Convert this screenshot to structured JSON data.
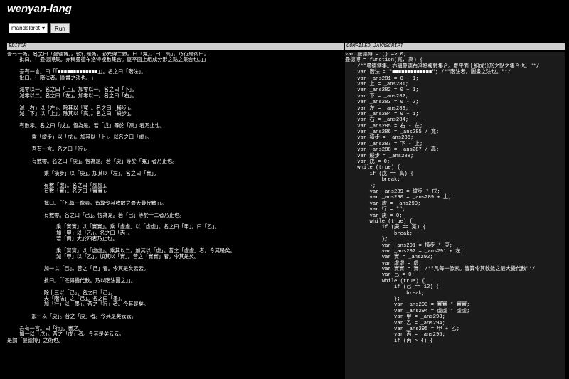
{
  "app": {
    "title": "wenyan-lang"
  },
  "toolbar": {
    "example_selected": "mandelbrot",
    "run_label": "Run"
  },
  "panes": {
    "editor_title": "EDITOR",
    "compiled_title": "COMPILED JAVASCRIPT"
  },
  "editor_lines": [
    "吾有一術。名之曰「曼德博」。欲行是術。必先得二數。曰「寬」。曰「高」。乃行是術曰。",
    "    批曰。「「曼德博集。亦稱曼德布洛特複數集合。夏平面上組成分形之點之集合也。」」",
    "",
    "    吾有一言。曰「「■■■■■■■■■■■■■」」。名之曰「階法」。",
    "    批曰。「「階法者。圖畫之法也。」」",
    "",
    "    減零以一。名之曰「上」。加零以一。名之曰「下」。",
    "    減零以二。名之曰「左」。加零以一。名之曰「右」。",
    "",
    "    減「右」以「左」。除其以「寬」。名之曰「橫步」。",
    "    減「下」以「上」。除其以「高」。名之曰「縱步」。",
    "",
    "    有數零。名之曰「戊」。恆為是。若「戊」等於「高」者乃止也。",
    "",
    "        乘「縱步」以「戊」。加其以「上」。以名之曰「虛」。",
    "",
    "        吾有一言。名之曰「行」。",
    "",
    "        有數零。名之曰「庚」。恆為是。若「庚」等於「寬」者乃止也。",
    "",
    "            乘「橫步」以「庚」。加其以「左」。名之曰「實」。",
    "",
    "            有數「虛」。名之曰「虛虛」。",
    "            有數「實」。名之曰「實實」。",
    "",
    "            批曰。「「凡每一像素。皆算令其收斂之最大疊代數」」。",
    "",
    "            有數零。名之曰「己」。恆為是。若「己」等於十二者乃止也。",
    "",
    "                乘「實實」以「實實」。乘「虛虛」以「虛虛」。名之曰「甲」。曰「乙」。",
    "                加「甲」以「乙」。名之曰「丙」。",
    "                若「丙」大於四者乃止也。",
    "",
    "                乘「實實」以「虛虛」。乘其以二。加其以「虛」。昔之「虛虛」者。今其是矣。",
    "                減「甲」以「乙」。加其以「實」。昔之「實實」者。今其是矣。",
    "",
    "            加一以「己」。昔之「己」者。今其是矣云云。",
    "",
    "            批曰。「「既得疊代數。乃以階法圖之」」。",
    "",
    "            除十三以「己」。名之曰「己」。",
    "            夫「階法」之「己」。名之曰「墨」。",
    "            加「行」以「墨」。昔之「行」者。今其是矣。",
    "",
    "        加一以「庚」。昔之「庚」者。今其是矣云云。",
    "",
    "    吾有一言。曰「行」。書之。",
    "    加一以「戊」。昔之「戊」者。今其是矣云云。",
    "是謂「曼德博」之術也。"
  ],
  "compiled_lines": [
    "var 曼德博 = () => 0;",
    "曼德博 = function(寬, 高) {",
    "    /*\"曼德博集。亦稱曼德布洛特複數集合。夏平面上組成分形之點之集合也。\"*/",
    "    var 階法 = \"■■■■■■■■■■■■■\"; /*\"階法者。圖畫之法也。\"*/",
    "    var _ans281 = 0 - 1;",
    "    var 上 = _ans281;",
    "    var _ans282 = 0 + 1;",
    "    var 下 = _ans282;",
    "    var _ans283 = 0 - 2;",
    "    var 左 = _ans283;",
    "    var _ans284 = 0 + 1;",
    "    var 右 = _ans284;",
    "    var _ans285 = 右 - 左;",
    "    var _ans286 = _ans285 / 寬;",
    "    var 橫步 = _ans286;",
    "    var _ans287 = 下 - 上;",
    "    var _ans288 = _ans287 / 高;",
    "    var 縱步 = _ans288;",
    "    var 戊 = 0;",
    "    while (true) {",
    "        if (戊 == 高) {",
    "            break;",
    "        };",
    "        var _ans289 = 縱步 * 戊;",
    "        var _ans290 = _ans289 + 上;",
    "        var 虛 = _ans290;",
    "        var 行 = \"\";",
    "        var 庚 = 0;",
    "        while (true) {",
    "            if (庚 == 寬) {",
    "                break;",
    "            };",
    "            var _ans291 = 橫步 * 庚;",
    "            var _ans292 = _ans291 + 左;",
    "            var 實 = _ans292;",
    "            var 虛虛 = 虛;",
    "            var 實實 = 實; /*\"凡每一像素。皆算令其收斂之最大疊代數\"*/",
    "            var 己 = 0;",
    "            while (true) {",
    "                if (己 == 12) {",
    "                    break;",
    "                };",
    "                var _ans293 = 實實 * 實實;",
    "                var _ans294 = 虛虛 * 虛虛;",
    "                var 甲 = _ans293;",
    "                var 乙 = _ans294;",
    "                var _ans295 = 甲 + 乙;",
    "                var 丙 = _ans295;",
    "                if (丙 > 4) {"
  ]
}
